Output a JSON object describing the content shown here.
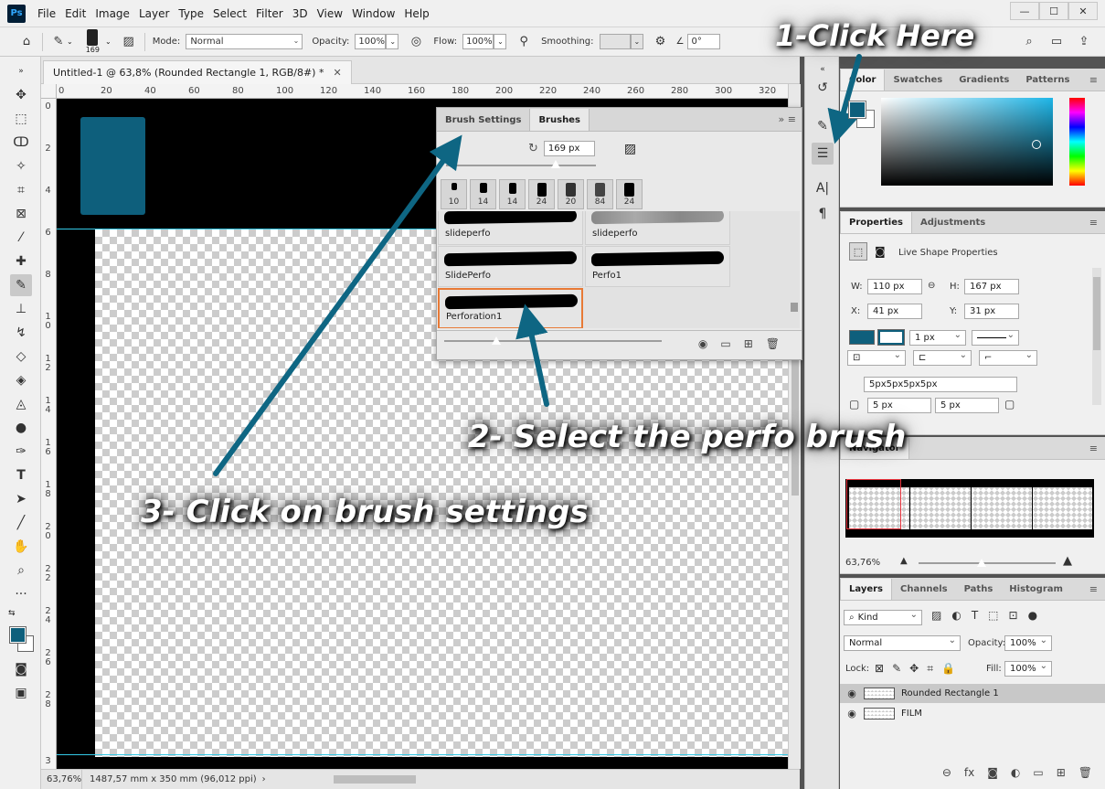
{
  "menubar": {
    "logo": "Ps",
    "items": [
      "File",
      "Edit",
      "Image",
      "Layer",
      "Type",
      "Select",
      "Filter",
      "3D",
      "View",
      "Window",
      "Help"
    ]
  },
  "options": {
    "brush_size": "169",
    "mode_label": "Mode:",
    "mode_value": "Normal",
    "opacity_label": "Opacity:",
    "opacity_value": "100%",
    "flow_label": "Flow:",
    "flow_value": "100%",
    "smoothing_label": "Smoothing:",
    "angle_value": "0°"
  },
  "document": {
    "tab_title": "Untitled-1 @ 63,8% (Rounded Rectangle 1, RGB/8#) *",
    "ruler_h": [
      "0",
      "20",
      "40",
      "60",
      "80",
      "100",
      "120",
      "140",
      "160",
      "180",
      "200",
      "220",
      "240",
      "260",
      "280",
      "300",
      "320"
    ],
    "ruler_v": [
      "0",
      "2",
      "4",
      "6",
      "8",
      "10",
      "12",
      "14",
      "16",
      "18",
      "20",
      "22",
      "24",
      "26",
      "28",
      "3"
    ],
    "status_zoom": "63,76%",
    "status_info": "1487,57 mm x 350 mm (96,012 ppi)",
    "fg_color": "#0e5f7c"
  },
  "brushes_panel": {
    "tab_settings": "Brush Settings",
    "tab_brushes": "Brushes",
    "size_value": "169 px",
    "presets": [
      "10",
      "14",
      "14",
      "24",
      "20",
      "84",
      "24"
    ],
    "items": [
      {
        "label": "slideperfo"
      },
      {
        "label": "slideperfo"
      },
      {
        "label": "SlidePerfo"
      },
      {
        "label": "Perfo1"
      },
      {
        "label": "Perforation1"
      }
    ]
  },
  "color_panel": {
    "tab_color": "Color",
    "tab_swatches": "Swatches",
    "tab_gradients": "Gradients",
    "tab_patterns": "Patterns"
  },
  "properties_panel": {
    "tab_properties": "Properties",
    "tab_adjustments": "Adjustments",
    "heading": "Live Shape Properties",
    "w_label": "W:",
    "w_value": "110 px",
    "h_label": "H:",
    "h_value": "167 px",
    "x_label": "X:",
    "x_value": "41 px",
    "y_label": "Y:",
    "y_value": "31 px",
    "stroke_width": "1 px",
    "corners_value": "5px5px5px5px",
    "corner_a": "5 px",
    "corner_b": "5 px"
  },
  "navigator_panel": {
    "tab_navigator": "Navigator",
    "zoom_value": "63,76%"
  },
  "layers_panel": {
    "tab_layers": "Layers",
    "tab_channels": "Channels",
    "tab_paths": "Paths",
    "tab_histogram": "Histogram",
    "filter_kind": "Kind",
    "blend_mode": "Normal",
    "opacity_label": "Opacity:",
    "opacity_value": "100%",
    "lock_label": "Lock:",
    "fill_label": "Fill:",
    "fill_value": "100%",
    "layers": [
      {
        "name": "Rounded Rectangle 1"
      },
      {
        "name": "FILM"
      }
    ]
  },
  "annotations": {
    "step1": "1-Click Here",
    "step2": "2- Select the perfo brush",
    "step3": "3- Click on brush settings",
    "arrow_color": "#0e6683"
  }
}
